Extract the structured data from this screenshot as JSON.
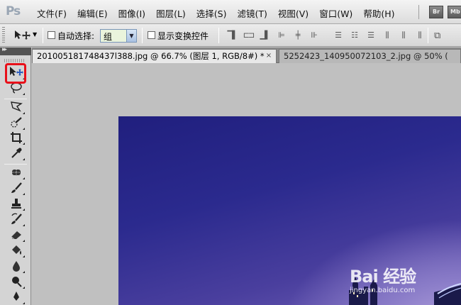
{
  "app": {
    "logo": "Ps"
  },
  "menu": {
    "items": [
      "文件(F)",
      "编辑(E)",
      "图像(I)",
      "图层(L)",
      "选择(S)",
      "滤镜(T)",
      "视图(V)",
      "窗口(W)",
      "帮助(H)"
    ],
    "bridge_button": "Br",
    "minibridge_button": "Mb"
  },
  "options": {
    "auto_select_label": "自动选择:",
    "auto_select_checked": false,
    "auto_select_value": "组",
    "show_transform_label": "显示变换控件",
    "show_transform_checked": false
  },
  "tabs": [
    {
      "label": "201005181748437l388.jpg @ 66.7% (图层 1, RGB/8#) *",
      "active": true
    },
    {
      "label": "5252423_140950072103_2.jpg @ 50% (",
      "active": false
    }
  ],
  "tab_close_glyph": "×",
  "tools": [
    "move-tool",
    "lasso-tool",
    "polygon-lasso-tool",
    "quick-selection-tool",
    "crop-tool",
    "eyedropper-tool",
    "healing-brush-tool",
    "brush-tool",
    "clone-stamp-tool",
    "history-brush-tool",
    "eraser-tool",
    "paint-bucket-tool",
    "blur-tool",
    "dodge-tool"
  ],
  "annotation": {
    "highlight_color": "#e8101a",
    "arrow_color": "#e8101a"
  },
  "watermark": {
    "main": "Bai 经验",
    "sub": "jingyan.baidu.com"
  }
}
